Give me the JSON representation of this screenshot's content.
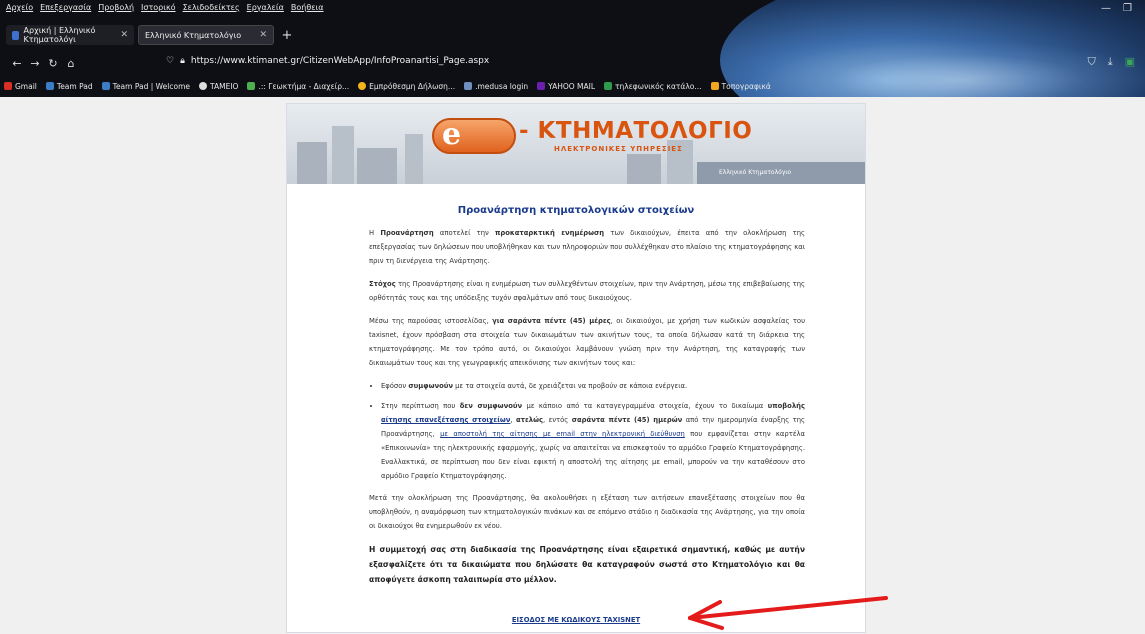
{
  "menubar": [
    "Αρχείο",
    "Επεξεργασία",
    "Προβολή",
    "Ιστορικό",
    "Σελιδοδείκτες",
    "Εργαλεία",
    "Βοήθεια"
  ],
  "tabs": [
    {
      "title": "Αρχική | Ελληνικό Κτηματολόγι",
      "color": "#3f6fd0"
    },
    {
      "title": "Ελληνικό Κτηματολόγιο",
      "color": "#6a6a6a"
    }
  ],
  "url": "https://www.ktimanet.gr/CitizenWebApp/InfoProanartisi_Page.aspx",
  "bookmarks": [
    {
      "label": "Gmail",
      "color": "#d93025"
    },
    {
      "label": "Team Pad",
      "color": "#3b7cc4"
    },
    {
      "label": "Team Pad | Welcome",
      "color": "#3b7cc4"
    },
    {
      "label": "TAMEIO",
      "color": "#ffffff"
    },
    {
      "label": ".:: Γεωκτήμα - Διαχείρ...",
      "color": "#4caf50"
    },
    {
      "label": "Εμπρόθεσμη Δήλωση...",
      "color": "#f2b51e"
    },
    {
      "label": ".medusa login",
      "color": "#6f8fbf"
    },
    {
      "label": "YAHOO MAIL",
      "color": "#6a1fb0"
    },
    {
      "label": "τηλεφωνικός κατάλο...",
      "color": "#2e9a4a"
    },
    {
      "label": "Τοπογραφικά",
      "color": "#f2a51e"
    }
  ],
  "logo": {
    "letter": "e",
    "title": "- ΚΤΗΜΑΤΟΛΟΓΙΟ",
    "subtitle": "ΗΛΕΚΤΡΟΝΙΚΕΣ ΥΠΗΡΕΣΙΕΣ",
    "corner": "Ελληνικό Κτηματολόγιο"
  },
  "page": {
    "heading": "Προανάρτηση κτηματολογικών στοιχείων",
    "p1a": "Η ",
    "p1b": "Προανάρτηση",
    "p1c": " αποτελεί την ",
    "p1d": "προκαταρκτική ενημέρωση",
    "p1e": " των δικαιούχων, έπειτα από την ολοκλήρωση της επεξεργασίας των δηλώσεων που υποβλήθηκαν και των πληροφοριών που συλλέχθηκαν στο πλαίσιο της κτηματογράφησης και πριν τη διενέργεια της Ανάρτησης.",
    "p2a": "Στόχος",
    "p2b": " της Προανάρτησης είναι η ενημέρωση των συλλεχθέντων στοιχείων, πριν την Ανάρτηση, μέσω της επιβεβαίωσης της ορθότητάς τους και της υπόδειξης τυχόν σφαλμάτων από τους δικαιούχους.",
    "p3a": "Μέσω της παρούσας ιστοσελίδας, ",
    "p3b": "για σαράντα πέντε (45) μέρες",
    "p3c": ", οι δικαιούχοι, με χρήση των κωδικών ασφαλείας του taxisnet, έχουν πρόσβαση στα στοιχεία των δικαιωμάτων των ακινήτων τους, τα οποία δήλωσαν κατά τη διάρκεια της κτηματογράφησης. Με τον τρόπο αυτό, οι δικαιούχοι λαμβάνουν γνώση πριν την Ανάρτηση, της καταγραφής των δικαιωμάτων τους και της γεωγραφικής απεικόνισης των ακινήτων τους και:",
    "b1a": "Εφόσον ",
    "b1b": "συμφωνούν",
    "b1c": " με τα στοιχεία αυτά, δε χρειάζεται να προβούν σε κάποια ενέργεια.",
    "b2a": "Στην περίπτωση που ",
    "b2b": "δεν συμφωνούν",
    "b2c": " με κάποιο από τα καταγεγραμμένα στοιχεία, έχουν το δικαίωμα ",
    "b2d": "υποβολής ",
    "b2e": "αίτησης επανεξέτασης στοιχείων",
    "b2f": ", ",
    "b2g": "ατελώς",
    "b2h": ", εντός ",
    "b2i": "σαράντα πέντε (45) ημερών",
    "b2j": " από την ημερομηνία έναρξης της Προανάρτησης, ",
    "b2k": "με αποστολή της αίτησης με email στην ηλεκτρονική διεύθυνση",
    "b2l": " που εμφανίζεται στην καρτέλα «Επικοινωνία» της ηλεκτρονικής εφαρμογής, χωρίς να απαιτείται να επισκεφτούν το αρμόδιο Γραφείο Κτηματογράφησης. Εναλλακτικά, σε περίπτωση που δεν είναι εφικτή η αποστολή της αίτησης με email, μπορούν να την καταθέσουν στο αρμόδιο Γραφείο Κτηματογράφησης.",
    "p4": "Μετά την ολοκλήρωση της Προανάρτησης, θα ακολουθήσει η εξέταση των αιτήσεων επανεξέτασης στοιχείων που θα υποβληθούν, η αναμόρφωση των κτηματολογικών πινάκων και σε επόμενο στάδιο η διαδικασία της Ανάρτησης, για την οποία οι δικαιούχοι θα ενημερωθούν εκ νέου.",
    "p5": "Η συμμετοχή σας στη διαδικασία της Προανάρτησης είναι εξαιρετικά σημαντική, καθώς με αυτήν εξασφαλίζετε ότι τα δικαιώματα που δηλώσατε θα καταγραφούν σωστά στο Κτηματολόγιο και θα αποφύγετε άσκοπη ταλαιπωρία στο μέλλον.",
    "taxis": "ΕΙΣΟΔΟΣ ΜΕ ΚΩΔΙΚΟΥΣ TAXISNET"
  },
  "colors": {
    "accent": "#1a3a8c",
    "brand": "#d9540f",
    "arrow": "#e31b1b"
  }
}
